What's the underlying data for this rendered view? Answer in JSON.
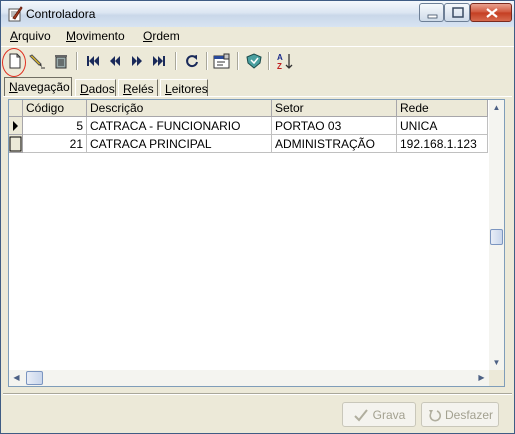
{
  "window": {
    "title": "Controladora"
  },
  "menu": [
    {
      "first": "A",
      "rest": "rquivo"
    },
    {
      "first": "M",
      "rest": "ovimento"
    },
    {
      "first": "O",
      "rest": "rdem"
    }
  ],
  "toolbar_icons": [
    "new-document-icon",
    "edit-pencil-icon",
    "delete-trash-icon",
    "first-record-icon",
    "previous-record-icon",
    "next-record-icon",
    "last-record-icon",
    "refresh-icon",
    "properties-icon",
    "security-icon",
    "sort-az-icon"
  ],
  "tabs": [
    {
      "first": "N",
      "rest": "avegação"
    },
    {
      "first": "D",
      "rest": "ados"
    },
    {
      "first": "R",
      "rest": "elés"
    },
    {
      "first": "L",
      "rest": "eitores"
    }
  ],
  "grid": {
    "columns": [
      "Código",
      "Descrição",
      "Setor",
      "Rede"
    ],
    "rows": [
      {
        "codigo": "5",
        "descricao": "CATRACA - FUNCIONARIO",
        "setor": "PORTAO 03",
        "rede": "UNICA"
      },
      {
        "codigo": "21",
        "descricao": "CATRACA PRINCIPAL",
        "setor": "ADMINISTRAÇÃO",
        "rede": "192.168.1.123"
      }
    ]
  },
  "buttons": {
    "save": "Grava",
    "undo": "Desfazer"
  },
  "colors": {
    "highlight": "#e03020",
    "title_gradient": "#dce6f2"
  }
}
